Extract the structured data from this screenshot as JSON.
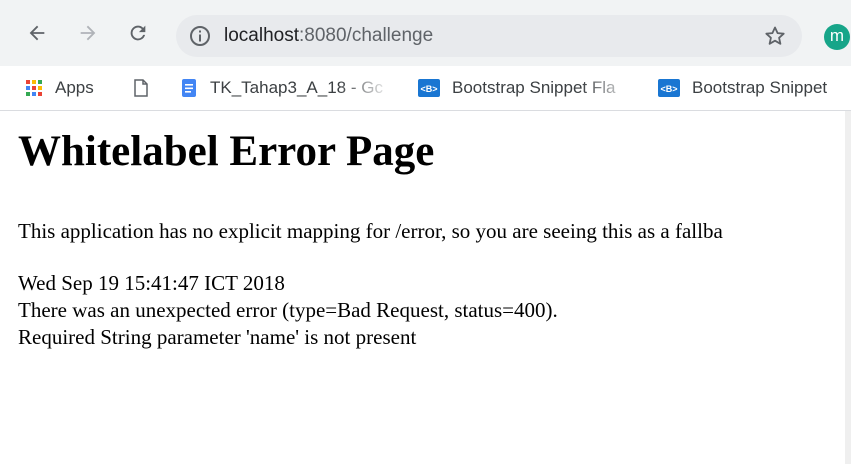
{
  "browser": {
    "url_host": "localhost",
    "url_port": ":8080",
    "url_path": "/challenge",
    "profile_initial": "m",
    "profile_color": "#17a589"
  },
  "bookmarks": [
    {
      "label": "Apps",
      "icon": "apps-grid-icon"
    },
    {
      "label": "",
      "icon": "page-icon"
    },
    {
      "label": "TK_Tahap3_A_18 - Gc",
      "icon": "google-docs-icon"
    },
    {
      "label": "Bootstrap Snippet Fla",
      "icon": "bootstrap-icon"
    },
    {
      "label": "Bootstrap Snippet",
      "icon": "bootstrap-icon"
    }
  ],
  "page": {
    "title": "Whitelabel Error Page",
    "message": "This application has no explicit mapping for /error, so you are seeing this as a fallba",
    "timestamp": "Wed Sep 19 15:41:47 ICT 2018",
    "error_line": "There was an unexpected error (type=Bad Request, status=400).",
    "detail_line": "Required String parameter 'name' is not present"
  }
}
